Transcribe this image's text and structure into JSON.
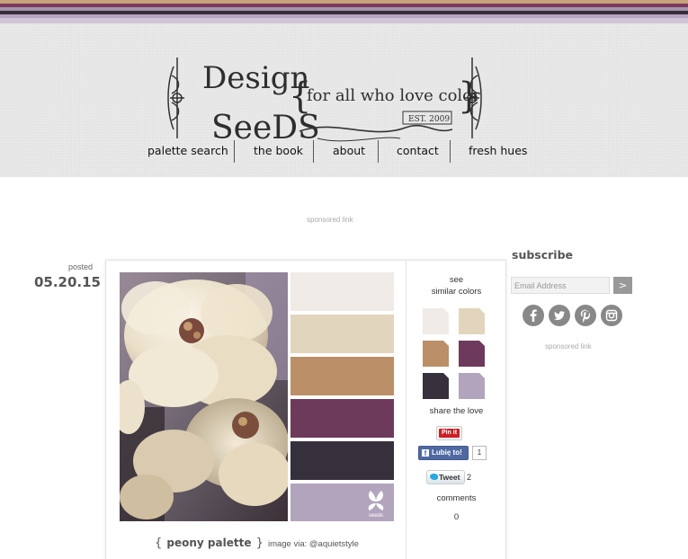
{
  "colors": {
    "stripes": [
      "#c7a27b",
      "#7a3a5e",
      "#a394ab",
      "#3a2d3b",
      "#b5a4bd"
    ],
    "palette": [
      "#f0ebe7",
      "#e1d6bd",
      "#bb9068",
      "#6e3a5c",
      "#35303c",
      "#b3a4bd"
    ]
  },
  "header": {
    "logo_alt": "Design Seeds",
    "logo_title_1": "Design",
    "logo_title_2": "SeeDS",
    "logo_tagline": "for all who love color",
    "logo_est": "EST. 2009"
  },
  "nav": {
    "items": [
      {
        "label": "palette search"
      },
      {
        "label": "the book"
      },
      {
        "label": "about"
      },
      {
        "label": "contact"
      },
      {
        "label": "fresh hues"
      }
    ]
  },
  "sponsored_top": "sponsored link",
  "post": {
    "posted_label": "posted",
    "date": "05.20.15",
    "palette_name": "peony palette",
    "brace_open": "{",
    "brace_close": "}",
    "image_credit": "image via: @aquietstyle",
    "seeds_mark": "seeds"
  },
  "side": {
    "see_label": "see",
    "similar_label": "similar colors",
    "share_label": "share the love",
    "pinit_label": "Pin it",
    "fb_icon": "f",
    "fb_label": "Lubię to!",
    "fb_count": "1",
    "tweet_label": "Tweet",
    "tweet_count": "2",
    "comments_label": "comments",
    "comments_count": "0"
  },
  "subscribe": {
    "title": "subscribe",
    "email_placeholder": "Email Address",
    "submit_label": ">",
    "social_icons": [
      "facebook-icon",
      "twitter-icon",
      "pinterest-icon",
      "instagram-icon"
    ],
    "sponsored": "sponsored link"
  }
}
